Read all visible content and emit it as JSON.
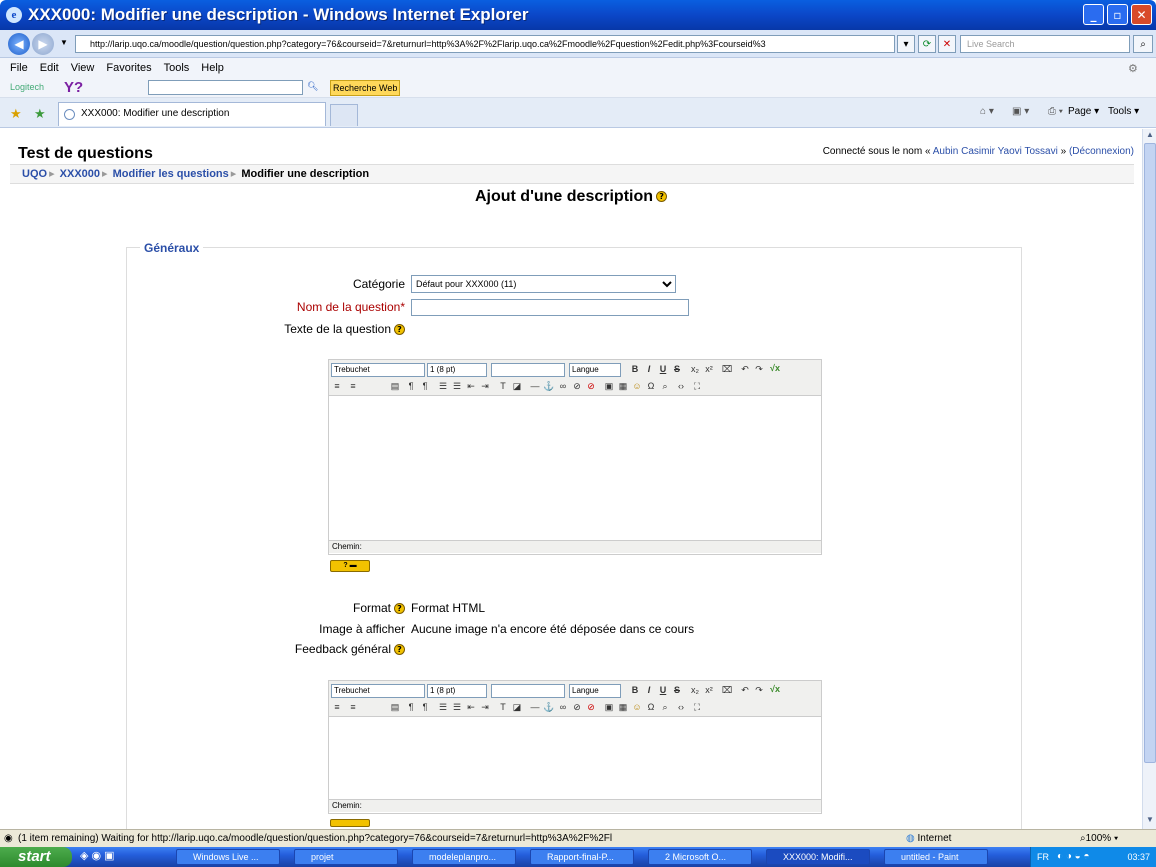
{
  "window": {
    "title": "XXX000: Modifier une description - Windows Internet Explorer"
  },
  "address": {
    "url": "http://larip.uqo.ca/moodle/question/question.php?category=76&courseid=7&returnurl=http%3A%2F%2Flarip.uqo.ca%2Fmoodle%2Fquestion%2Fedit.php%3Fcourseid%3",
    "search_placeholder": "Live Search"
  },
  "menu": [
    "File",
    "Edit",
    "View",
    "Favorites",
    "Tools",
    "Help"
  ],
  "toolbar": {
    "logitech": "Logitech",
    "y": "Y?",
    "recherche": "Recherche Web"
  },
  "tab": {
    "label": "XXX000: Modifier une description"
  },
  "cmdbar": {
    "page": "Page",
    "tools": "Tools"
  },
  "page": {
    "header": "Test de questions",
    "login_prefix": "Connecté sous le nom «",
    "login_user": "Aubin Casimir Yaovi Tossavi",
    "login_suffix": "»",
    "logout": "(Déconnexion)",
    "breadcrumb": [
      "UQO",
      "XXX000",
      "Modifier les questions",
      "Modifier une description"
    ],
    "title": "Ajout d'une description",
    "section": "Généraux",
    "category_label": "Catégorie",
    "category_value": "Défaut pour XXX000 (11)",
    "name_label": "Nom de la question",
    "name_required": "*",
    "text_label": "Texte de la question",
    "format_label": "Format",
    "format_value": "Format HTML",
    "image_label": "Image à afficher",
    "image_value": "Aucune image n'a encore été déposée dans ce cours",
    "feedback_label": "Feedback général"
  },
  "editor": {
    "font": "Trebuchet",
    "size": "1 (8 pt)",
    "lang": "Langue",
    "path": "Chemin:"
  },
  "status": {
    "text": "(1 item remaining) Waiting for http://larip.uqo.ca/moodle/question/question.php?category=76&courseid=7&returnurl=http%3A%2F%2Fl",
    "zone": "Internet",
    "zoom": "100%"
  },
  "taskbar": {
    "start": "start",
    "tasks": [
      "Windows Live ...",
      "projet",
      "modeleplanpro...",
      "Rapport-final-P...",
      "2 Microsoft O...",
      "XXX000: Modifi...",
      "untitled - Paint"
    ],
    "lang": "FR",
    "clock": "03:37"
  }
}
